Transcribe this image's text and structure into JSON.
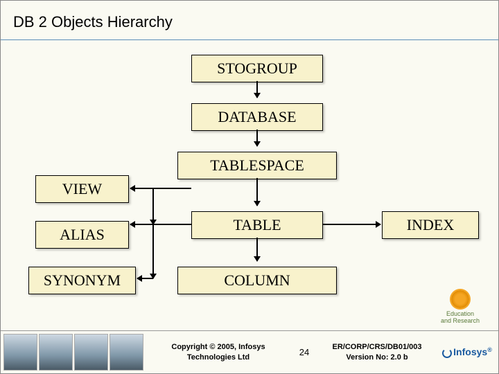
{
  "title": "DB 2 Objects Hierarchy",
  "nodes": {
    "stogroup": "STOGROUP",
    "database": "DATABASE",
    "tablespace": "TABLESPACE",
    "view": "VIEW",
    "alias": "ALIAS",
    "synonym": "SYNONYM",
    "table": "TABLE",
    "column": "COLUMN",
    "index": "INDEX"
  },
  "edges": [
    {
      "from": "stogroup",
      "to": "database"
    },
    {
      "from": "database",
      "to": "tablespace"
    },
    {
      "from": "tablespace",
      "to": "table"
    },
    {
      "from": "table",
      "to": "column"
    },
    {
      "from": "table",
      "to": "view"
    },
    {
      "from": "table",
      "to": "alias"
    },
    {
      "from": "table",
      "to": "synonym"
    },
    {
      "from": "table",
      "to": "index"
    }
  ],
  "badge": {
    "line1": "Education",
    "line2": "and Research"
  },
  "footer": {
    "copyright_line1": "Copyright © 2005, Infosys",
    "copyright_line2": "Technologies Ltd",
    "page": "24",
    "ref_line1": "ER/CORP/CRS/DB01/003",
    "ref_line2": "Version No: 2.0 b",
    "logo": "Infosys"
  }
}
